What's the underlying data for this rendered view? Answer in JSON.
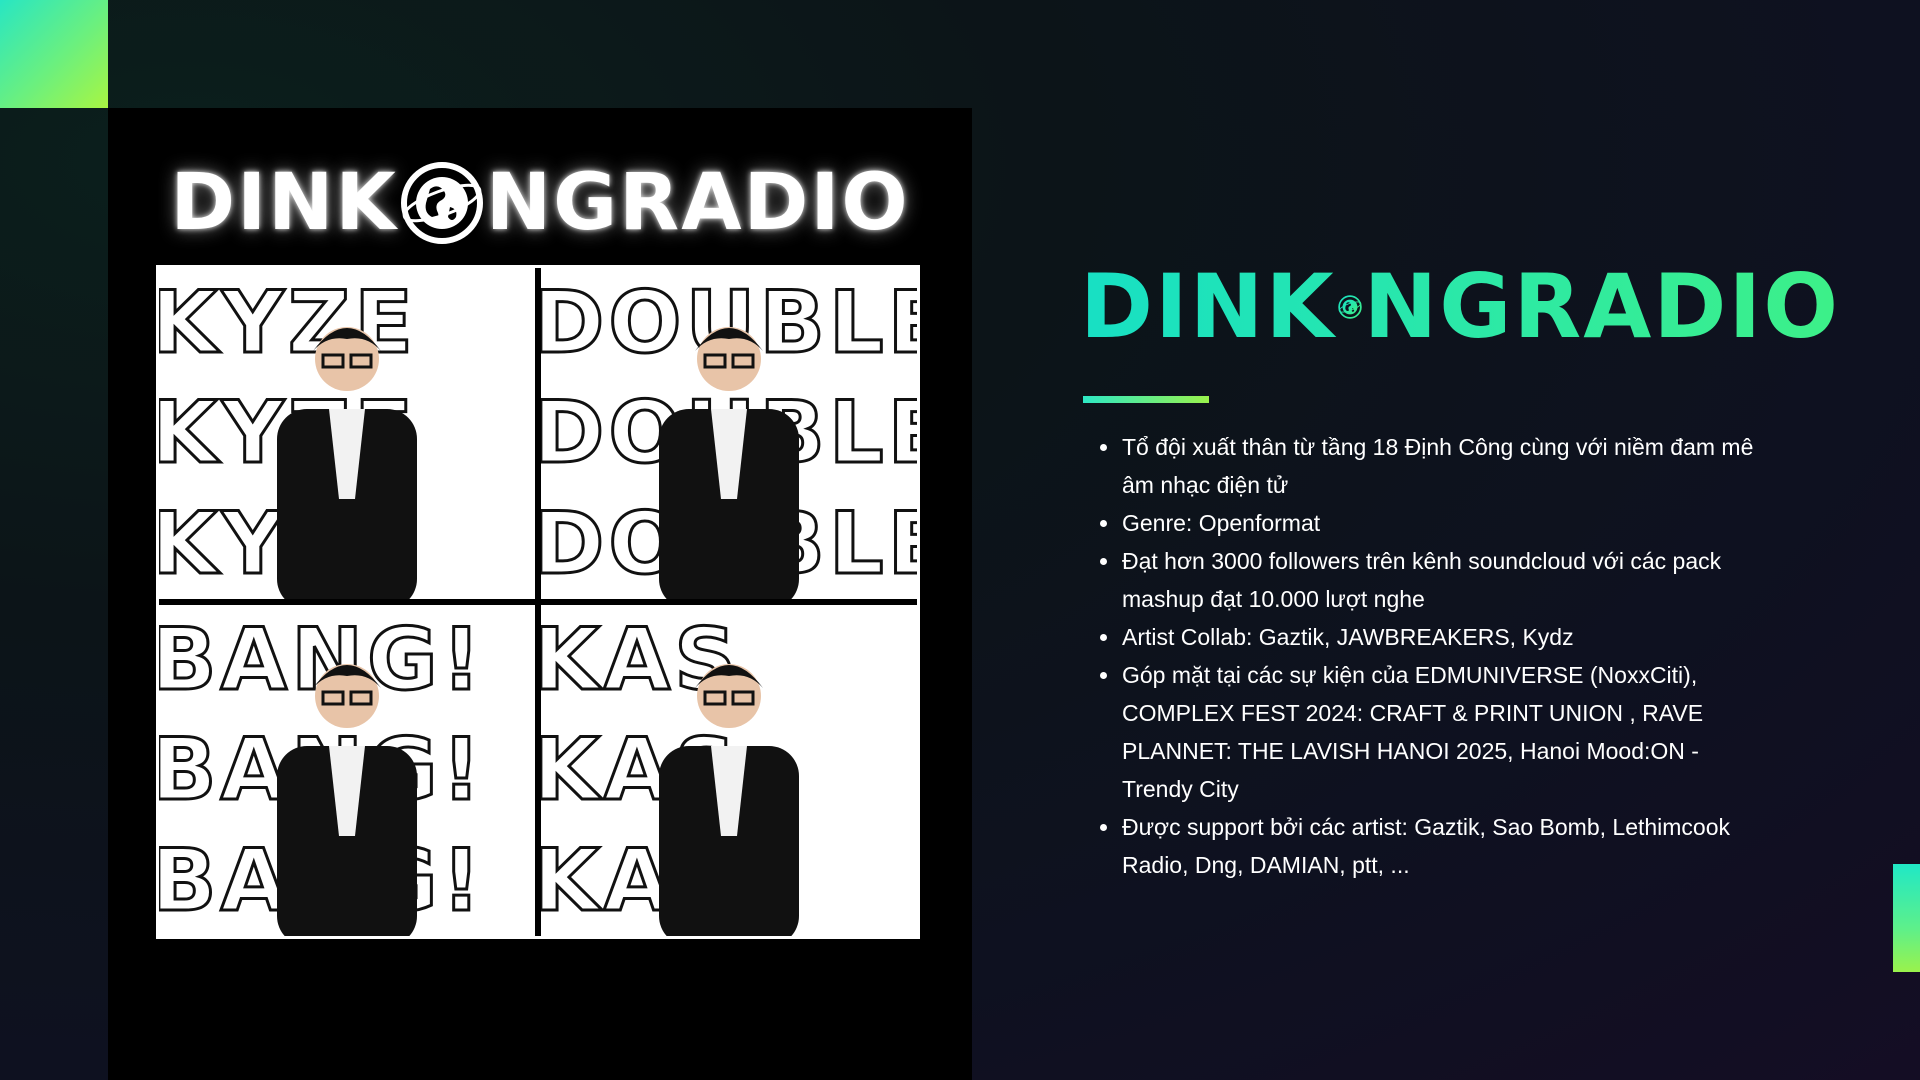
{
  "brand": {
    "name_left": "DINK",
    "name_right": "NGRADIO",
    "accent_colors": [
      "#17e0c4",
      "#3df088",
      "#a8f542"
    ]
  },
  "panel": {
    "logo_left": "DINK",
    "logo_right": "NGRADIO",
    "tiles": [
      {
        "word": "KYZE"
      },
      {
        "word": "DOUBLE H"
      },
      {
        "word": "BANG!"
      },
      {
        "word": "KAS"
      }
    ]
  },
  "info": {
    "items": [
      "Tổ đội xuất thân từ tầng 18 Định Công cùng với niềm đam mê âm nhạc điện tử",
      "Genre: Openformat",
      "Đạt hơn 3000 followers trên kênh soundcloud với các pack mashup đạt 10.000 lượt nghe",
      "Artist Collab: Gaztik, JAWBREAKERS,  Kydz",
      "Góp mặt tại các sự kiện của EDMUNIVERSE (NoxxCiti), COMPLEX FEST 2024: CRAFT & PRINT UNION , RAVE  PLANNET: THE LAVISH HANOI 2025, Hanoi Mood:ON - Trendy City",
      "Được support bởi các artist: Gaztik, Sao Bomb, Lethimcook Radio, Dng, DAMIAN, ptt, ..."
    ]
  }
}
